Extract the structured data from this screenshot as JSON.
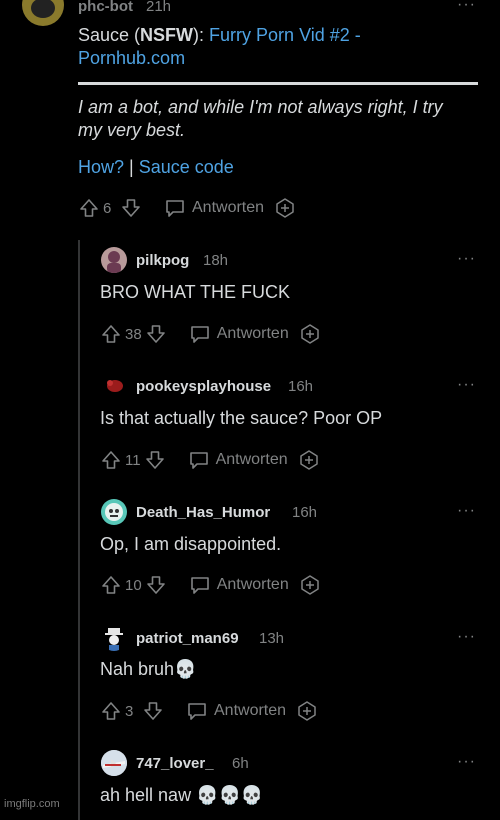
{
  "top_comment": {
    "author": "phc-bot",
    "time": "21h",
    "sauce_prefix": "Sauce (",
    "nsfw": "NSFW",
    "sauce_suffix": "): ",
    "sauce_link_line1": "Furry Porn Vid #2 -",
    "sauce_link_line2": "Pornhub.com",
    "bot_line1": "I am a bot, and while I'm not always right, I try",
    "bot_line2": "my very best.",
    "how_link": "How?",
    "separator": " | ",
    "code_link": "Sauce code",
    "score": "6",
    "reply_label": "Antworten"
  },
  "replies": [
    {
      "username": "pilkpog",
      "time": "18h",
      "text": "BRO WHAT THE FUCK",
      "score": "38",
      "reply_label": "Antworten"
    },
    {
      "username": "pookeysplayhouse",
      "time": "16h",
      "text": "Is that actually the sauce? Poor OP",
      "score": "11",
      "reply_label": "Antworten"
    },
    {
      "username": "Death_Has_Humor",
      "time": "16h",
      "text": "Op, I am disappointed.",
      "score": "10",
      "reply_label": "Antworten"
    },
    {
      "username": "patriot_man69",
      "time": "13h",
      "text": "Nah bruh💀",
      "score": "3",
      "reply_label": "Antworten"
    },
    {
      "username": "747_lover_",
      "time": "6h",
      "text": "ah hell naw 💀💀💀"
    }
  ],
  "icons": {
    "upvote": "arrow-up-icon",
    "downvote": "arrow-down-icon",
    "reply": "speech-bubble-icon",
    "award": "award-icon",
    "more": "more-dots-icon"
  },
  "colors": {
    "background": "#000000",
    "link": "#4fa3e3",
    "text": "#d7dadc",
    "muted": "#818384"
  },
  "more_glyph": "···",
  "watermark": "imgflip.com"
}
